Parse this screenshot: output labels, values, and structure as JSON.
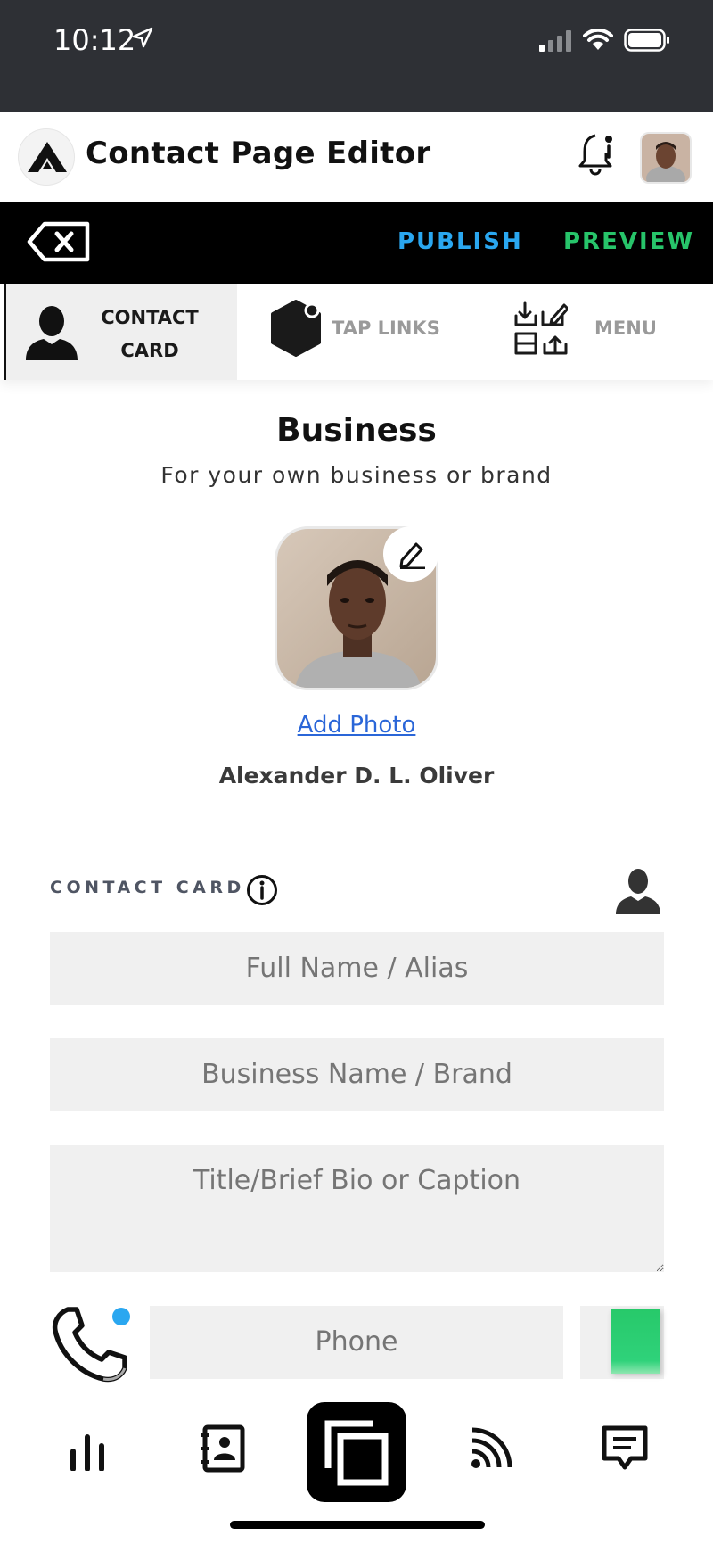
{
  "status_bar": {
    "time": "10:12"
  },
  "header": {
    "title": "Contact Page Editor"
  },
  "action_bar": {
    "publish": "PUBLISH",
    "preview": "PREVIEW"
  },
  "tabs": [
    {
      "label": "CONTACT CARD",
      "icon": "person-icon",
      "active": true
    },
    {
      "label": "TAP LINKS",
      "icon": "hexagon-icon",
      "active": false
    },
    {
      "label": "MENU",
      "icon": "menu-import-export-icon",
      "active": false
    }
  ],
  "profile": {
    "title": "Business",
    "subtitle": "For your own business or brand",
    "add_photo": "Add Photo",
    "name": "Alexander D. L. Oliver"
  },
  "contact_card": {
    "section_label": "CONTACT CARD",
    "fields": {
      "full_name": {
        "placeholder": "Full Name / Alias",
        "value": ""
      },
      "business": {
        "placeholder": "Business Name / Brand",
        "value": ""
      },
      "title_bio": {
        "placeholder": "Title/Brief Bio or Caption",
        "value": ""
      },
      "phone": {
        "placeholder": "Phone",
        "value": ""
      }
    }
  },
  "bottom_nav": [
    {
      "icon": "stats-icon"
    },
    {
      "icon": "contacts-icon"
    },
    {
      "icon": "pages-icon",
      "active": true
    },
    {
      "icon": "nfc-icon"
    },
    {
      "icon": "messages-icon"
    }
  ],
  "colors": {
    "publish": "#2aa7f0",
    "preview": "#27c46a",
    "link": "#2a66d8",
    "status_bar": "#2e3035"
  }
}
